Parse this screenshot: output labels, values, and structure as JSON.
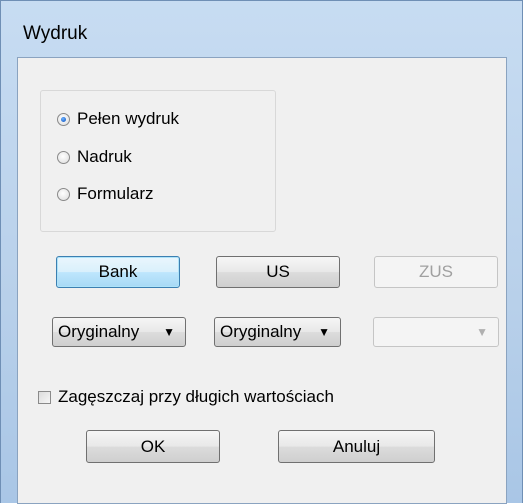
{
  "window": {
    "title": "Wydruk"
  },
  "print_mode": {
    "options": [
      {
        "label": "Pełen wydruk",
        "checked": true
      },
      {
        "label": "Nadruk",
        "checked": false
      },
      {
        "label": "Formularz",
        "checked": false
      }
    ]
  },
  "targets": {
    "bank_label": "Bank",
    "us_label": "US",
    "zus_label": "ZUS",
    "zus_enabled": false
  },
  "copies": {
    "bank_value": "Oryginalny",
    "us_value": "Oryginalny",
    "zus_value": "",
    "zus_enabled": false
  },
  "compress": {
    "label": "Zagęszczaj przy długich wartościach",
    "checked": false
  },
  "actions": {
    "ok_label": "OK",
    "cancel_label": "Anuluj"
  }
}
